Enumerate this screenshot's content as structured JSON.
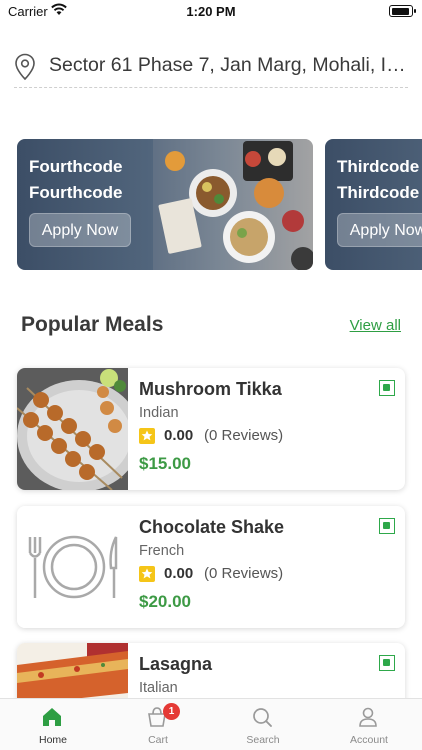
{
  "status_bar": {
    "carrier": "Carrier",
    "time": "1:20 PM"
  },
  "address": {
    "text": "Sector 61 Phase 7, Jan Marg, Mohali, In..."
  },
  "offers": [
    {
      "title": "Fourthcode",
      "subtitle": "Fourthcode",
      "button": "Apply Now"
    },
    {
      "title": "Thirdcode",
      "subtitle": "Thirdcode",
      "button": "Apply Now"
    }
  ],
  "popular": {
    "title": "Popular Meals",
    "view_all": "View all"
  },
  "meals": [
    {
      "name": "Mushroom Tikka",
      "cuisine": "Indian",
      "rating": "0.00",
      "reviews": "(0 Reviews)",
      "price": "$15.00",
      "image": "skewers-photo",
      "veg": true
    },
    {
      "name": "Chocolate Shake",
      "cuisine": "French",
      "rating": "0.00",
      "reviews": "(0 Reviews)",
      "price": "$20.00",
      "image": "plate-placeholder-icon",
      "veg": true
    },
    {
      "name": "Lasagna",
      "cuisine": "Italian",
      "image": "lasagna-photo",
      "veg": true
    }
  ],
  "tabs": [
    {
      "label": "Home",
      "icon": "home-icon",
      "active": true
    },
    {
      "label": "Cart",
      "icon": "cart-icon",
      "badge": "1"
    },
    {
      "label": "Search",
      "icon": "search-icon"
    },
    {
      "label": "Account",
      "icon": "account-icon"
    }
  ],
  "colors": {
    "accent_green": "#3d9a45",
    "veg_green": "#2ea84a",
    "badge_red": "#e53935",
    "star_yellow": "#f5c518"
  }
}
